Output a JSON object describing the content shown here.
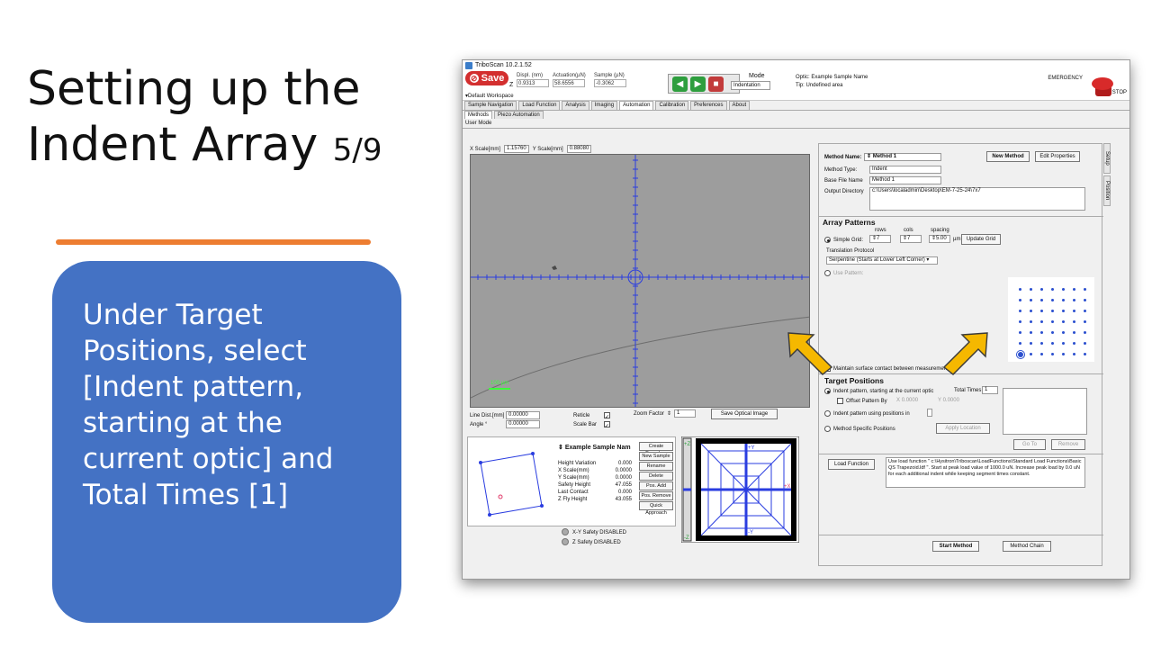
{
  "slide": {
    "title_line1": "Setting up the",
    "title_line2": "Indent Array ",
    "title_counter": "5/9",
    "callout": "Under Target Positions, select [Indent pattern, starting at the current optic] and Total Times [1]"
  },
  "colors": {
    "callout_bg": "#4472c4",
    "accent_rule": "#ed7d31",
    "arrow": "#f5b800",
    "save": "#d32f2f",
    "grid_dots": "#2a4fcf"
  },
  "window": {
    "title": "TriboScan 10.2.1.52",
    "save_label": "Save",
    "z_label": "Z",
    "readouts": [
      {
        "label": "Displ. (nm)",
        "value": "0.9313"
      },
      {
        "label": "Actuation(µN)",
        "value": "58.6556"
      },
      {
        "label": "Sample (µN)",
        "value": "-0.3062"
      }
    ],
    "mode_label": "Mode",
    "mode_value": "Indentation",
    "optic_label": "Optic:",
    "optic_value": "Example Sample Name",
    "tip_label": "Tip:",
    "tip_value": "Undefined area",
    "emergency_label": "EMERGENCY",
    "stop_label": "STOP",
    "workspace": "Default Workspace",
    "tabs": [
      "Sample Navigation",
      "Load Function",
      "Analysis",
      "Imaging",
      "Automation",
      "Calibration",
      "Preferences",
      "About"
    ],
    "active_tab": "Automation",
    "subtabs": [
      "Methods",
      "Piezo Automation"
    ],
    "user_mode": "User Mode"
  },
  "left": {
    "x_scale_label": "X Scale[mm]",
    "x_scale_value": "1.15760",
    "y_scale_label": "Y Scale[mm]",
    "y_scale_value": "0.88080",
    "scale_bar": "100 µm",
    "line_dist_label": "Line Dist.[mm]",
    "line_dist_value": "0.00000",
    "angle_label": "Angle °",
    "angle_value": "0.00000",
    "reticle_label": "Reticle",
    "scalebar_label": "Scale Bar",
    "zoom_label": "Zoom Factor",
    "zoom_value": "1",
    "save_optical": "Save Optical Image",
    "sample_name": "Example Sample Nam",
    "sample_rows": [
      {
        "k": "Height Variation",
        "v": "0.000"
      },
      {
        "k": "X Scale(mm)",
        "v": "0.0000"
      },
      {
        "k": "Y Scale(mm)",
        "v": "0.0000"
      },
      {
        "k": "Safety Height",
        "v": "47.055"
      },
      {
        "k": "Last Contact",
        "v": "0.000"
      },
      {
        "k": "Z Fly Height",
        "v": "43.055"
      }
    ],
    "sample_buttons": [
      "Create Boundary",
      "New Sample",
      "Rename",
      "Delete",
      "Pos. Add",
      "Pos. Remove",
      "Quick Approach"
    ],
    "xy_safety": "X-Y Safety DISABLED",
    "z_safety": "Z  Safety DISABLED",
    "stage_labels": {
      "top": "+Y",
      "bottom": "-Y",
      "right": "+X",
      "left_top": "+Z",
      "left_bottom": "-Z"
    }
  },
  "method": {
    "name_label": "Method Name:",
    "name_value": "Method 1",
    "new_method": "New Method",
    "edit_props": "Edit Properties",
    "type_label": "Method Type:",
    "type_value": "Indent",
    "base_label": "Base File Name",
    "base_value": "Method 1",
    "outdir_label": "Output Directory",
    "outdir_value": "c:\\Users\\localadmin\\Desktop\\EM-7-25-24\\7x7",
    "side_tabs": [
      "Setup",
      "Position"
    ],
    "array_header": "Array Patterns",
    "rows_label": "rows",
    "cols_label": "cols",
    "spacing_label": "spacing",
    "simple_grid": "Simple Grid:",
    "rows": "7",
    "cols": "7",
    "spacing": "5.00",
    "unit": "µm",
    "update_grid": "Update Grid",
    "translation_label": "Translation Protocol",
    "translation_value": "Serpentine (Starts at Lower Left Corner)",
    "use_pattern": "Use Pattern:",
    "maintain": "Maintain surface contact between measurements",
    "target_header": "Target Positions",
    "opt_current": "Indent pattern, starting at the current optic",
    "total_times_label": "Total Times",
    "total_times": "1",
    "offset_label": "Offset Pattern By",
    "offset_x_label": "X",
    "offset_x": "0.0000",
    "offset_y_label": "Y",
    "offset_y": "0.0000",
    "opt_positions": "Indent pattern using positions in",
    "opt_specific": "Method Specific Positions",
    "apply_location": "Apply Location",
    "goto": "Go To",
    "remove": "Remove",
    "load_function": "Load Function",
    "load_desc": "Use load function \" c:\\Hysitron\\Triboscan\\LoadFunctions\\Standard Load Functions\\Basic QS Trapezoid.ldf \". Start at peak load value of 1000.0 uN. Increase peak load by 0.0 uN for each additional indent while keeping segment times constant.",
    "start_method": "Start Method",
    "method_chain": "Method Chain"
  }
}
